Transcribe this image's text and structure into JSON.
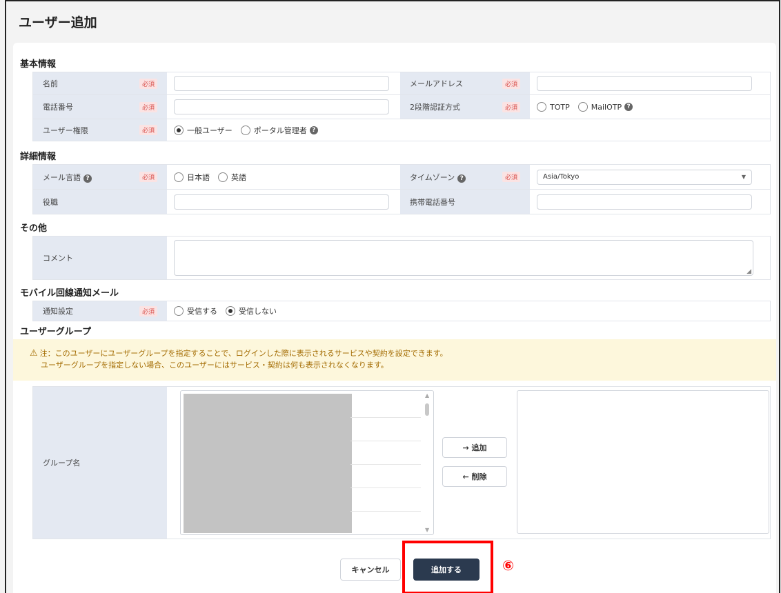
{
  "page_title": "ユーザー追加",
  "required_label": "必須",
  "sections": {
    "basic": "基本情報",
    "detail": "詳細情報",
    "other": "その他",
    "mobile": "モバイル回線通知メール",
    "group": "ユーザーグループ"
  },
  "basic": {
    "name_label": "名前",
    "email_label": "メールアドレス",
    "phone_label": "電話番号",
    "twofa_label": "2段階認証方式",
    "twofa_options": [
      "TOTP",
      "MailOTP"
    ],
    "role_label": "ユーザー権限",
    "role_options": [
      "一般ユーザー",
      "ポータル管理者"
    ]
  },
  "detail": {
    "mail_lang_label": "メール言語",
    "mail_lang_options": [
      "日本語",
      "英語"
    ],
    "timezone_label": "タイムゾーン",
    "timezone_value": "Asia/Tokyo",
    "position_label": "役職",
    "mobile_phone_label": "携帯電話番号"
  },
  "other": {
    "comment_label": "コメント"
  },
  "mobile": {
    "notify_label": "通知設定",
    "notify_options": [
      "受信する",
      "受信しない"
    ]
  },
  "group": {
    "notice_line1": "注：このユーザーにユーザーグループを指定することで、ログインした際に表示されるサービスや契約を設定できます。",
    "notice_line2": "ユーザーグループを指定しない場合、このユーザーにはサービス・契約は何も表示されなくなります。",
    "group_name_label": "グループ名",
    "add_button": "→ 追加",
    "remove_button": "← 削除"
  },
  "footer": {
    "cancel_button": "キャンセル",
    "submit_button": "追加する",
    "step_marker": "⑥"
  },
  "colors": {
    "label_bg": "#e4e9f2",
    "primary_button": "#2b3a4f",
    "notice_bg": "#fdf7dc",
    "highlight": "#ff0000"
  }
}
